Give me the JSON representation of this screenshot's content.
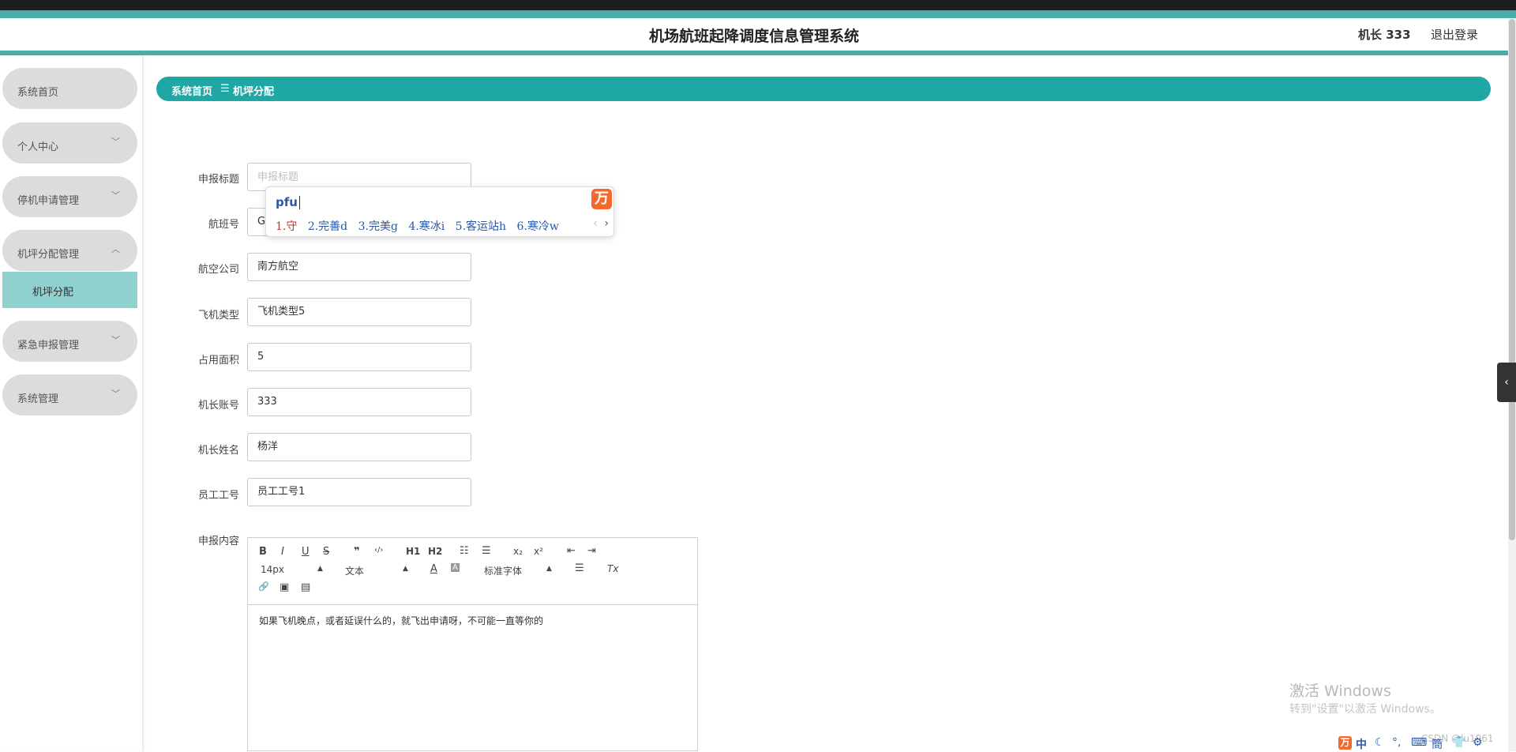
{
  "header": {
    "title": "机场航班起降调度信息管理系统",
    "user": "机长 333",
    "logout": "退出登录"
  },
  "sidebar": {
    "items": [
      {
        "label": "系统首页",
        "expandable": false
      },
      {
        "label": "个人中心",
        "expandable": true
      },
      {
        "label": "停机申请管理",
        "expandable": true
      },
      {
        "label": "机坪分配管理",
        "expandable": true,
        "expanded": true
      },
      {
        "label": "紧急申报管理",
        "expandable": true
      },
      {
        "label": "系统管理",
        "expandable": true
      }
    ],
    "submenu": {
      "label": "机坪分配"
    },
    "chevron_down": "﹀",
    "chevron_up": "︿"
  },
  "breadcrumb": {
    "home": "系统首页",
    "separator": "☰",
    "current": "机坪分配"
  },
  "form": {
    "title": {
      "label": "申报标题",
      "value": "",
      "placeholder": "申报标题"
    },
    "flight": {
      "label": "航班号",
      "value": "G"
    },
    "airline": {
      "label": "航空公司",
      "value": "南方航空"
    },
    "aircraft_type": {
      "label": "飞机类型",
      "value": "飞机类型5"
    },
    "area": {
      "label": "占用面积",
      "value": "5"
    },
    "captain_account": {
      "label": "机长账号",
      "value": "333"
    },
    "captain_name": {
      "label": "机长姓名",
      "value": "杨洋"
    },
    "employee_id": {
      "label": "员工工号",
      "value": "员工工号1"
    },
    "content": {
      "label": "申报内容",
      "value": "如果飞机晚点，或者延误什么的，就飞出申请呀，不可能一直等你的"
    }
  },
  "editor_toolbar": {
    "bold": "B",
    "italic": "I",
    "underline": "U",
    "strike": "S",
    "blockquote": "❞",
    "code": "‹/›",
    "h1": "H1",
    "h2": "H2",
    "ordered_list": "☷",
    "bullet_list": "☰",
    "subscript": "x₂",
    "superscript": "x²",
    "indent_less": "⇤",
    "indent_more": "⇥",
    "font_size": "14px",
    "header_select": "文本",
    "color": "A",
    "background": "A",
    "font_family": "标准字体",
    "align": "☰",
    "clean": "Tx",
    "link": "🔗",
    "image": "▣",
    "video": "▤"
  },
  "ime": {
    "input": "pfu",
    "logo": "🆕",
    "candidates": [
      "1.守",
      "2.完善d",
      "3.完美g",
      "4.寒冰i",
      "5.客运站h",
      "6.寒冷w"
    ],
    "prev": "‹",
    "next": "›"
  },
  "watermark": {
    "line1": "激活 Windows",
    "line2": "转到\"设置\"以激活 Windows。"
  },
  "csdn": "CSDN @lu1061",
  "side_tab": "‹",
  "tray": {
    "ime_logo": "🆕",
    "lang": "中",
    "icons": [
      "☾",
      "°,",
      "⌨",
      "簡",
      "👕",
      "⚙"
    ]
  },
  "colors": {
    "accent": "#1ea7a4",
    "header_line": "#4aaea8",
    "submenu_active": "#8fd1cf",
    "menu_bg": "#dcdcdc"
  }
}
